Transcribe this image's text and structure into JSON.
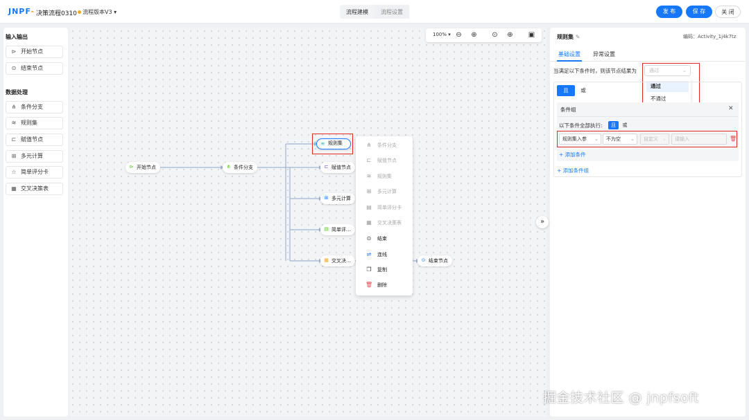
{
  "header": {
    "logo_main": "JNPF",
    "logo_accent": "-",
    "app_title": "决策流程0310",
    "version": "流程版本V3",
    "version_caret": "▾",
    "tabs": [
      "流程建模",
      "流程设置"
    ],
    "buttons": {
      "publish": "发 布",
      "save": "保 存",
      "close": "关 闭"
    }
  },
  "sidebar": {
    "section_io": "输入输出",
    "io_items": [
      {
        "label": "开始节点",
        "icon": "play-circle-icon"
      },
      {
        "label": "结束节点",
        "icon": "stop-circle-icon"
      }
    ],
    "section_data": "数据处理",
    "data_items": [
      {
        "label": "条件分支",
        "icon": "branch-icon"
      },
      {
        "label": "规则集",
        "icon": "layers-icon"
      },
      {
        "label": "赋值节点",
        "icon": "assign-icon"
      },
      {
        "label": "多元计算",
        "icon": "calculator-icon"
      },
      {
        "label": "简单评分卡",
        "icon": "star-icon"
      },
      {
        "label": "交叉决策表",
        "icon": "table-icon"
      }
    ]
  },
  "toolbar": {
    "zoom": "100%",
    "zoom_caret": "▾"
  },
  "nodes": {
    "start": "开始节点",
    "branch": "条件分支",
    "ruleset": "规则集",
    "assign": "赋值节点",
    "multicalc": "多元计算",
    "scorecard": "简单评...",
    "crosstable": "交叉决...",
    "end": "结束节点"
  },
  "context_menu": [
    {
      "label": "条件分支",
      "icon": "branch-icon",
      "enabled": false
    },
    {
      "label": "赋值节点",
      "icon": "assign-icon",
      "enabled": false
    },
    {
      "label": "规则集",
      "icon": "layers-icon",
      "enabled": false
    },
    {
      "label": "多元计算",
      "icon": "calculator-icon",
      "enabled": false
    },
    {
      "label": "简单评分卡",
      "icon": "scorecard-icon",
      "enabled": false
    },
    {
      "label": "交叉决策表",
      "icon": "table-icon",
      "enabled": false
    },
    {
      "label": "结束",
      "icon": "stop-circle-icon",
      "enabled": true
    },
    {
      "label": "连线",
      "icon": "connect-icon",
      "enabled": true
    },
    {
      "label": "复制",
      "icon": "copy-icon",
      "enabled": true
    },
    {
      "label": "删除",
      "icon": "trash-icon",
      "enabled": true
    }
  ],
  "collapse_glyph": "»",
  "panel": {
    "title": "规则集",
    "code": "编码：Activity_1j4k7tz",
    "tabs": [
      "基础设置",
      "异常设置"
    ],
    "condition_label": "当满足以下条件时，则该节点结果为",
    "result_placeholder": "通过",
    "result_options": [
      "通过",
      "不通过"
    ],
    "logic": [
      "且",
      "或"
    ],
    "group_title": "条件组",
    "exec_label": "以下条件全部执行:",
    "exec_logic": [
      "且",
      "或"
    ],
    "condition_row": {
      "field": "规则集入参",
      "operator": "不为空",
      "value_type": "自定义",
      "value_placeholder": "请输入"
    },
    "add_condition": "+ 添加条件",
    "add_group": "+ 添加条件组"
  },
  "watermark": "掘金技术社区 @ jnpfsoft",
  "colors": {
    "primary": "#1677ff",
    "accent": "#f5a623",
    "highlight": "#e5281f",
    "danger": "#e5484d"
  }
}
